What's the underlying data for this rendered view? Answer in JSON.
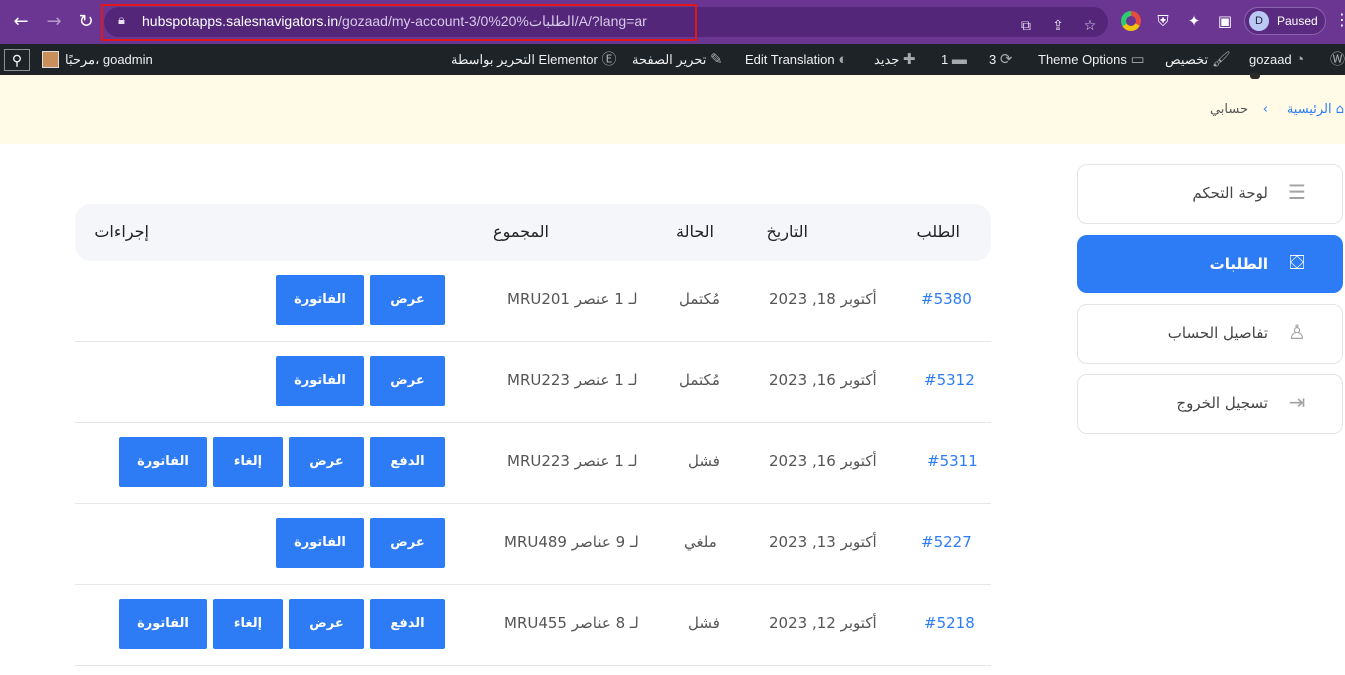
{
  "browser": {
    "url_host": "hubspotapps.salesnavigators.in",
    "url_path": "/gozaad/my-account-3/0%20%الطلبات/A/?lang=ar",
    "profile_initial": "D",
    "profile_status": "Paused"
  },
  "admin_bar": {
    "greeting": "مرحبًا، goadmin",
    "elementor": "التحرير بواسطة Elementor",
    "edit_page": "تحرير الصفحة",
    "edit_translation": "Edit Translation",
    "new": "جديد",
    "comments_count": "1",
    "updates_count": "3",
    "theme_options": "Theme Options",
    "customize": "تخصيص",
    "site_name": "gozaad"
  },
  "breadcrumb": {
    "home": "الرئيسية",
    "current": "حسابي"
  },
  "sidebar": {
    "items": [
      {
        "label": "لوحة التحكم",
        "icon": "sliders-icon",
        "active": false
      },
      {
        "label": "الطلبات",
        "icon": "shopping-bag-icon",
        "active": true
      },
      {
        "label": "تفاصيل الحساب",
        "icon": "user-icon",
        "active": false
      },
      {
        "label": "تسجيل الخروج",
        "icon": "logout-icon",
        "active": false
      }
    ]
  },
  "orders": {
    "headers": {
      "order": "الطلب",
      "date": "التاريخ",
      "status": "الحالة",
      "total": "المجموع",
      "actions": "إجراءات"
    },
    "rows": [
      {
        "order": "#5380",
        "date": "أكتوبر 18, 2023",
        "status": "مُكتمل",
        "total": "MRU201 لـ 1 عنصر",
        "actions": [
          "عرض",
          "الفاتورة"
        ]
      },
      {
        "order": "#5312",
        "date": "أكتوبر 16, 2023",
        "status": "مُكتمل",
        "total": "MRU223 لـ 1 عنصر",
        "actions": [
          "عرض",
          "الفاتورة"
        ]
      },
      {
        "order": "#5311",
        "date": "أكتوبر 16, 2023",
        "status": "فشل",
        "total": "MRU223 لـ 1 عنصر",
        "actions": [
          "الدفع",
          "عرض",
          "إلغاء",
          "الفاتورة"
        ]
      },
      {
        "order": "#5227",
        "date": "أكتوبر 13, 2023",
        "status": "ملغي",
        "total": "MRU489 لـ 9 عناصر",
        "actions": [
          "عرض",
          "الفاتورة"
        ]
      },
      {
        "order": "#5218",
        "date": "أكتوبر 12, 2023",
        "status": "فشل",
        "total": "MRU455 لـ 8 عناصر",
        "actions": [
          "الدفع",
          "عرض",
          "إلغاء",
          "الفاتورة"
        ]
      }
    ]
  },
  "colors": {
    "accent": "#2d7cf6",
    "browser_frame": "#6a3691",
    "admin_bar": "#1d2327",
    "hero_bg": "#fffbe6",
    "url_highlight": "#e3161b"
  }
}
